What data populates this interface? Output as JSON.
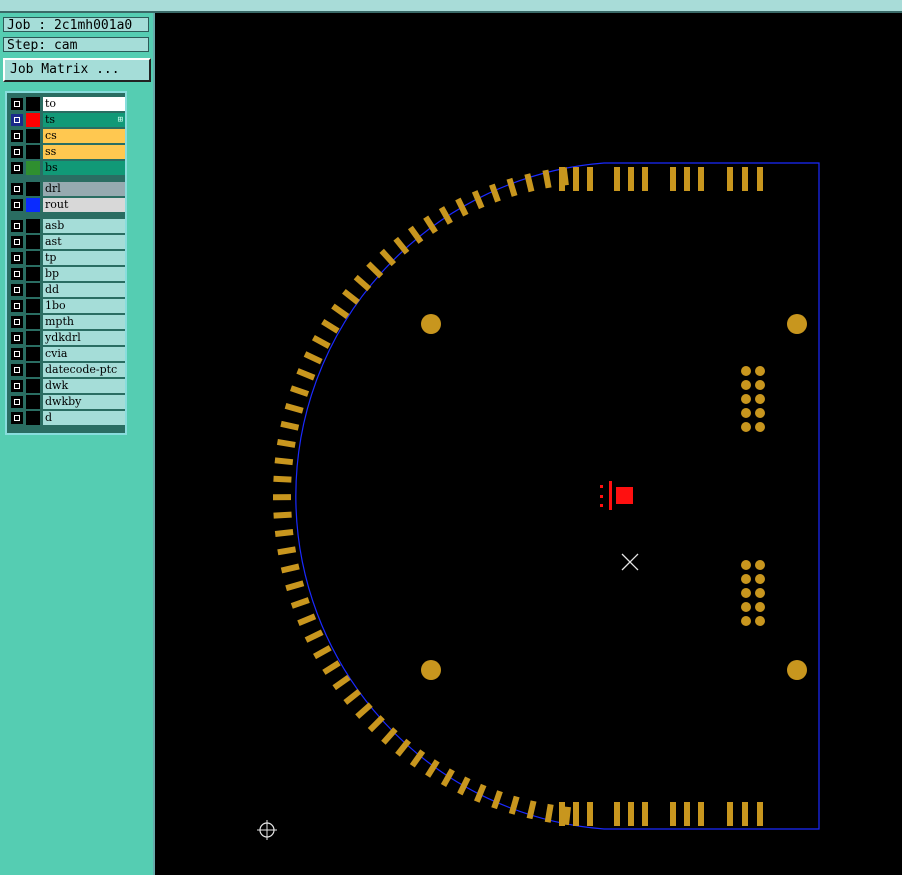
{
  "header": {
    "job_label": "Job : 2c1mh001a0",
    "step_label": "Step: cam",
    "matrix_button": "Job Matrix ..."
  },
  "layers": [
    {
      "name": "to",
      "color": "#000000",
      "bg": "#ffffff",
      "group": 0
    },
    {
      "name": "ts",
      "color": "#ff0000",
      "bg": "#119977",
      "group": 0,
      "active": true
    },
    {
      "name": "cs",
      "color": "#000000",
      "bg": "#ffc850",
      "group": 0
    },
    {
      "name": "ss",
      "color": "#000000",
      "bg": "#ffc850",
      "group": 0
    },
    {
      "name": "bs",
      "color": "#2f8f2f",
      "bg": "#119977",
      "group": 0
    },
    {
      "name": "drl",
      "color": "#000000",
      "bg": "#96aab0",
      "group": 1
    },
    {
      "name": "rout",
      "color": "#0a2bff",
      "bg": "#d8d8d8",
      "group": 1
    },
    {
      "name": "asb",
      "color": "#000000",
      "bg": "#a5ddd8",
      "group": 2
    },
    {
      "name": "ast",
      "color": "#000000",
      "bg": "#a5ddd8",
      "group": 2
    },
    {
      "name": "tp",
      "color": "#000000",
      "bg": "#a5ddd8",
      "group": 2
    },
    {
      "name": "bp",
      "color": "#000000",
      "bg": "#a5ddd8",
      "group": 2
    },
    {
      "name": "dd",
      "color": "#000000",
      "bg": "#a5ddd8",
      "group": 2
    },
    {
      "name": "1bo",
      "color": "#000000",
      "bg": "#a5ddd8",
      "group": 2
    },
    {
      "name": "mpth",
      "color": "#000000",
      "bg": "#a5ddd8",
      "group": 2
    },
    {
      "name": "ydkdrl",
      "color": "#000000",
      "bg": "#a5ddd8",
      "group": 2
    },
    {
      "name": "cvia",
      "color": "#000000",
      "bg": "#a5ddd8",
      "group": 2
    },
    {
      "name": "datecode-ptc",
      "color": "#000000",
      "bg": "#a5ddd8",
      "group": 2
    },
    {
      "name": "dwk",
      "color": "#000000",
      "bg": "#a5ddd8",
      "group": 2
    },
    {
      "name": "dwkby",
      "color": "#000000",
      "bg": "#a5ddd8",
      "group": 2
    },
    {
      "name": "d",
      "color": "#000000",
      "bg": "#a5ddd8",
      "group": 2
    }
  ],
  "colors": {
    "pad": "#c8961e",
    "outline": "#1a2aff",
    "marker": "#ff1010",
    "crosshair": "#e6e6e6"
  }
}
